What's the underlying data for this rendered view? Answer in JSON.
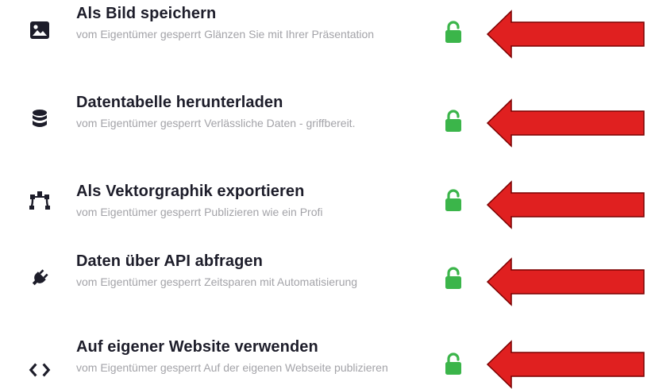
{
  "colors": {
    "title": "#1d1d2a",
    "description": "#a3a3a8",
    "lock_green": "#3bb54a",
    "arrow_red": "#e02020",
    "arrow_outline": "#7a0000",
    "icon_dark": "#1d1d2a"
  },
  "features": [
    {
      "icon": "image-icon",
      "title": "Als Bild speichern",
      "description": "vom Eigentümer gesperrt Glänzen Sie mit Ihrer Präsentation",
      "status_icon": "unlocked-lock-icon"
    },
    {
      "icon": "database-icon",
      "title": "Datentabelle herunterladen",
      "description": "vom Eigentümer gesperrt Verlässliche Daten - griffbereit.",
      "status_icon": "unlocked-lock-icon"
    },
    {
      "icon": "vector-icon",
      "title": "Als Vektorgraphik exportieren",
      "description": "vom Eigentümer gesperrt Publizieren wie ein Profi",
      "status_icon": "unlocked-lock-icon"
    },
    {
      "icon": "plug-icon",
      "title": "Daten über API abfragen",
      "description": "vom Eigentümer gesperrt Zeitsparen mit Automatisierung",
      "status_icon": "unlocked-lock-icon"
    },
    {
      "icon": "code-icon",
      "title": "Auf eigener Website verwenden",
      "description": "vom Eigentümer gesperrt Auf der eigenen Webseite publizieren",
      "status_icon": "unlocked-lock-icon"
    }
  ]
}
